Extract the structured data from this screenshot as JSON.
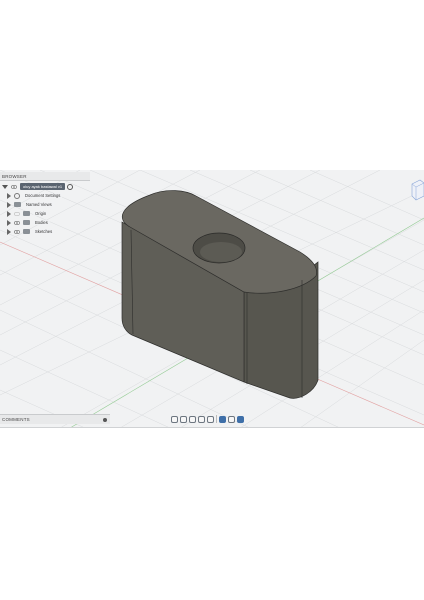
{
  "browser": {
    "title": "BROWSER",
    "root_label": "oluy ayak bastawal v1",
    "items": [
      {
        "label": "Document Settings",
        "icon": "gear-icon"
      },
      {
        "label": "Named Views",
        "icon": "folder-icon"
      },
      {
        "label": "Origin",
        "icon": "folder-icon"
      },
      {
        "label": "Bodies",
        "icon": "folder-icon"
      },
      {
        "label": "Sketches",
        "icon": "folder-icon"
      }
    ]
  },
  "comments": {
    "title": "COMMENTS"
  },
  "toolbar": {
    "tools": [
      "orbit-icon",
      "pan-icon",
      "look-at-icon",
      "zoom-icon",
      "fit-icon",
      "display-settings-icon",
      "grid-icon",
      "viewports-icon"
    ]
  },
  "colors": {
    "viewport_bg": "#f1f2f3",
    "grid": "#d4d6d8",
    "model_top": "#67655e",
    "model_side": "#5b5a54",
    "edge": "#2e2e2c",
    "axis_red": "#d98a8a",
    "axis_green": "#7ec07e",
    "axis_blue": "#8aa6d8",
    "root_bg": "#5a6470"
  }
}
